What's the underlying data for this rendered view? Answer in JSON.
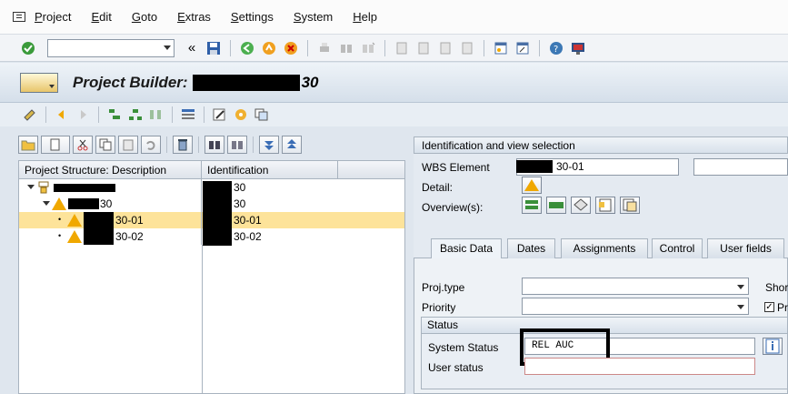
{
  "menu": [
    "Project",
    "Edit",
    "Goto",
    "Extras",
    "Settings",
    "System",
    "Help"
  ],
  "toolbar": {
    "command_value": "",
    "icons": [
      "check-icon",
      "history-icon",
      "save-icon",
      "back-icon",
      "exit-icon",
      "cancel-icon",
      "print-icon",
      "find-icon",
      "find-next-icon",
      "first-page-icon",
      "prev-page-icon",
      "next-page-icon",
      "last-page-icon",
      "new-session-icon",
      "shortcut-icon",
      "help-icon",
      "customize-layout-icon"
    ]
  },
  "title": {
    "prefix": "Project Builder:",
    "suffix": "30"
  },
  "tree": {
    "col1": "Project Structure: Description",
    "col2": "Identification",
    "rows": [
      {
        "desc": "",
        "id": "30"
      },
      {
        "desc": "30",
        "id": "30"
      },
      {
        "desc": "30-01",
        "id": "30-01"
      },
      {
        "desc": "30-02",
        "id": "30-02"
      }
    ]
  },
  "right": {
    "section_title": "Identification and view selection",
    "wbs_label": "WBS Element",
    "wbs_value": "30-01",
    "detail_label": "Detail:",
    "overview_label": "Overview(s):",
    "tabs": [
      "Basic Data",
      "Dates",
      "Assignments",
      "Control",
      "User fields"
    ],
    "projtype_label": "Proj.type",
    "priority_label": "Priority",
    "short_label": "Shor",
    "pr_label": "Pr",
    "status_title": "Status",
    "system_status_label": "System Status",
    "system_status_value": "REL  AUC",
    "user_status_label": "User status"
  },
  "colors": {
    "selected_row": "#fde39a",
    "warning": "#f0a800"
  }
}
